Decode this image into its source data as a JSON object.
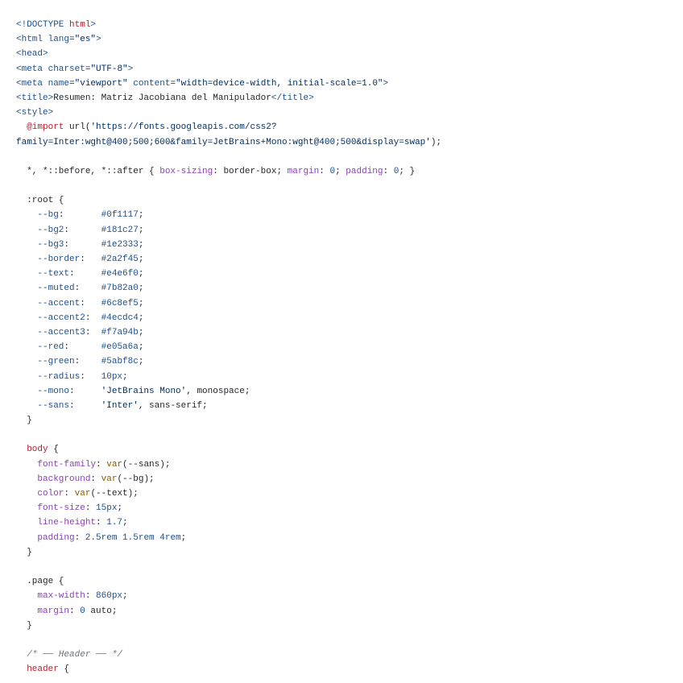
{
  "code_lines": [
    "<!DOCTYPE html>",
    "<html lang=\"es\">",
    "<head>",
    "<meta charset=\"UTF-8\">",
    "<meta name=\"viewport\" content=\"width=device-width, initial-scale=1.0\">",
    "<title>Resumen: Matriz Jacobiana del Manipulador</title>",
    "<style>",
    "  @import url('https://fonts.googleapis.com/css2?",
    "family=Inter:wght@400;500;600&family=JetBrains+Mono:wght@400;500&display=swap');",
    "",
    "  *, *::before, *::after { box-sizing: border-box; margin: 0; padding: 0; }",
    "",
    "  :root {",
    "    --bg:       #0f1117;",
    "    --bg2:      #181c27;",
    "    --bg3:      #1e2333;",
    "    --border:   #2a2f45;",
    "    --text:     #e4e6f0;",
    "    --muted:    #7b82a0;",
    "    --accent:   #6c8ef5;",
    "    --accent2:  #4ecdc4;",
    "    --accent3:  #f7a94b;",
    "    --red:      #e05a6a;",
    "    --green:    #5abf8c;",
    "    --radius:   10px;",
    "    --mono:     'JetBrains Mono', monospace;",
    "    --sans:     'Inter', sans-serif;",
    "  }",
    "",
    "  body {",
    "    font-family: var(--sans);",
    "    background: var(--bg);",
    "    color: var(--text);",
    "    font-size: 15px;",
    "    line-height: 1.7;",
    "    padding: 2.5rem 1.5rem 4rem;",
    "  }",
    "",
    "  .page {",
    "    max-width: 860px;",
    "    margin: 0 auto;",
    "  }",
    "",
    "  /* ── Header ── */",
    "  header {"
  ]
}
